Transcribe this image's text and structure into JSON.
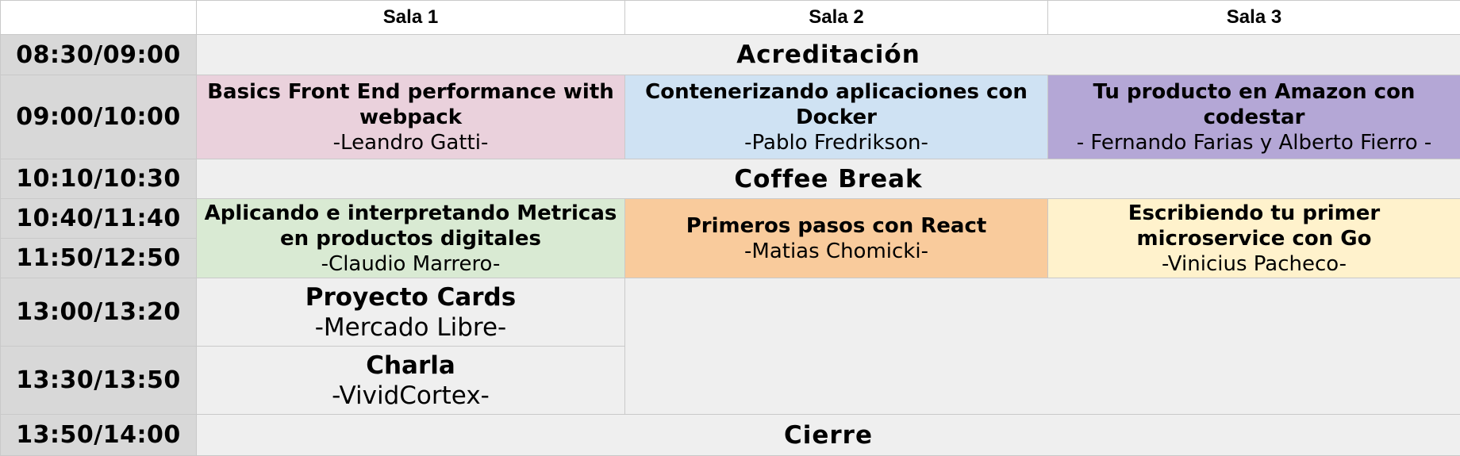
{
  "header": {
    "rooms": [
      "Sala 1",
      "Sala 2",
      "Sala 3"
    ]
  },
  "times": [
    "08:30/09:00",
    "09:00/10:00",
    "10:10/10:30",
    "10:40/11:40",
    "11:50/12:50",
    "13:00/13:20",
    "13:30/13:50",
    "13:50/14:00"
  ],
  "plenary": {
    "acreditacion": "Acreditación",
    "coffee": "Coffee Break",
    "cierre": "Cierre"
  },
  "talks": {
    "t1": {
      "title": "Basics Front End performance with webpack",
      "speaker": "-Leandro Gatti-",
      "color": "#ead1dc"
    },
    "t2": {
      "title": "Contenerizando aplicaciones con Docker",
      "speaker": "-Pablo Fredrikson-",
      "color": "#cfe2f3"
    },
    "t3": {
      "title": "Tu producto en Amazon con codestar",
      "speaker": "- Fernando Farias y Alberto Fierro -",
      "color": "#b4a7d6"
    },
    "t4": {
      "title": "Aplicando e interpretando Metricas en productos digitales",
      "speaker": "-Claudio Marrero-",
      "color": "#d9ead3"
    },
    "t5": {
      "title": "Primeros pasos con React",
      "speaker": "-Matias Chomicki-",
      "color": "#f9cb9c"
    },
    "t6": {
      "title": "Escribiendo tu primer microservice con Go",
      "speaker": "-Vinicius Pacheco-",
      "color": "#fff2cc"
    },
    "t7": {
      "title": "Proyecto Cards",
      "speaker": "-Mercado Libre-",
      "color": "#efefef"
    },
    "t8": {
      "title": "Charla",
      "speaker": "-VividCortex-",
      "color": "#efefef"
    }
  }
}
